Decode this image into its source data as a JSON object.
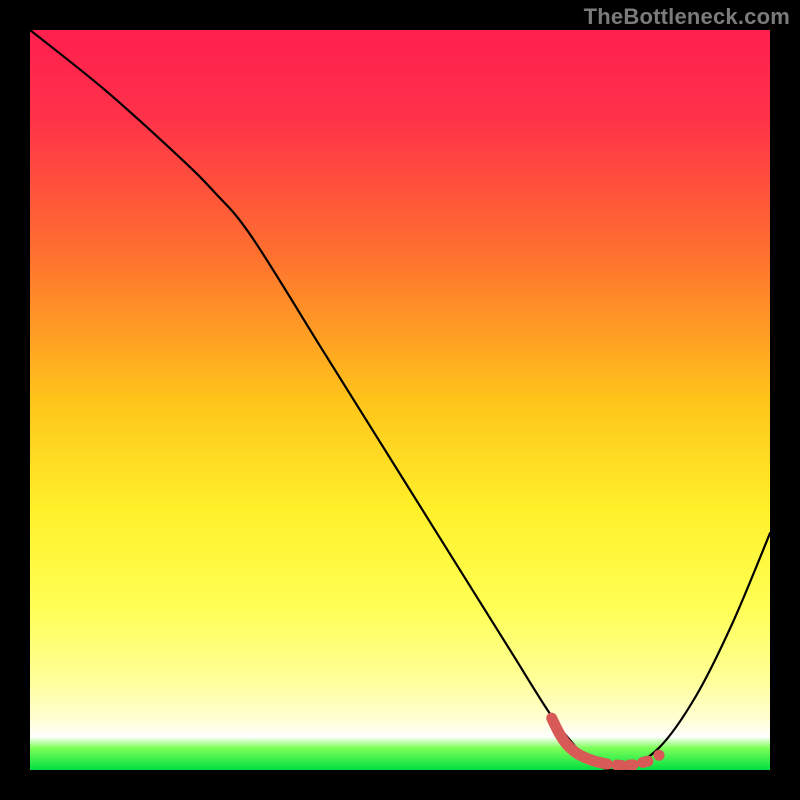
{
  "watermark": "TheBottleneck.com",
  "chart_data": {
    "type": "line",
    "title": "",
    "xlabel": "",
    "ylabel": "",
    "xlim": [
      0,
      100
    ],
    "ylim": [
      0,
      100
    ],
    "background_gradient_stops": [
      {
        "pos": 0.0,
        "color": "#ff1f4f"
      },
      {
        "pos": 0.12,
        "color": "#ff3249"
      },
      {
        "pos": 0.3,
        "color": "#ff6f2f"
      },
      {
        "pos": 0.5,
        "color": "#ffc41a"
      },
      {
        "pos": 0.65,
        "color": "#fff12a"
      },
      {
        "pos": 0.78,
        "color": "#ffff55"
      },
      {
        "pos": 0.88,
        "color": "#ffff9a"
      },
      {
        "pos": 0.93,
        "color": "#ffffd2"
      },
      {
        "pos": 0.955,
        "color": "#ffffff"
      },
      {
        "pos": 0.97,
        "color": "#7fff5a"
      },
      {
        "pos": 1.0,
        "color": "#00e040"
      }
    ],
    "series": [
      {
        "name": "bottleneck-curve",
        "stroke": "#000000",
        "x": [
          0,
          10,
          20,
          25,
          30,
          40,
          50,
          60,
          65,
          70,
          73,
          76,
          80,
          85,
          90,
          95,
          100
        ],
        "y": [
          100,
          92,
          83,
          78,
          72,
          56,
          40,
          24,
          16,
          8,
          4,
          1,
          0,
          3,
          10,
          20,
          32
        ]
      }
    ],
    "highlight_segments": [
      {
        "name": "optimal-range",
        "stroke": "#d85a57",
        "points": [
          {
            "x": 70.5,
            "y": 7.0
          },
          {
            "x": 71.5,
            "y": 5.0
          },
          {
            "x": 72.5,
            "y": 3.5
          },
          {
            "x": 74.0,
            "y": 2.2
          },
          {
            "x": 76.0,
            "y": 1.3
          },
          {
            "x": 78.0,
            "y": 0.8
          }
        ],
        "dashes_after": [
          {
            "x": 80.0,
            "y": 0.6
          },
          {
            "x": 81.5,
            "y": 0.7
          },
          {
            "x": 83.5,
            "y": 1.2
          }
        ],
        "final_dot": {
          "x": 85.0,
          "y": 2.0
        }
      }
    ]
  }
}
